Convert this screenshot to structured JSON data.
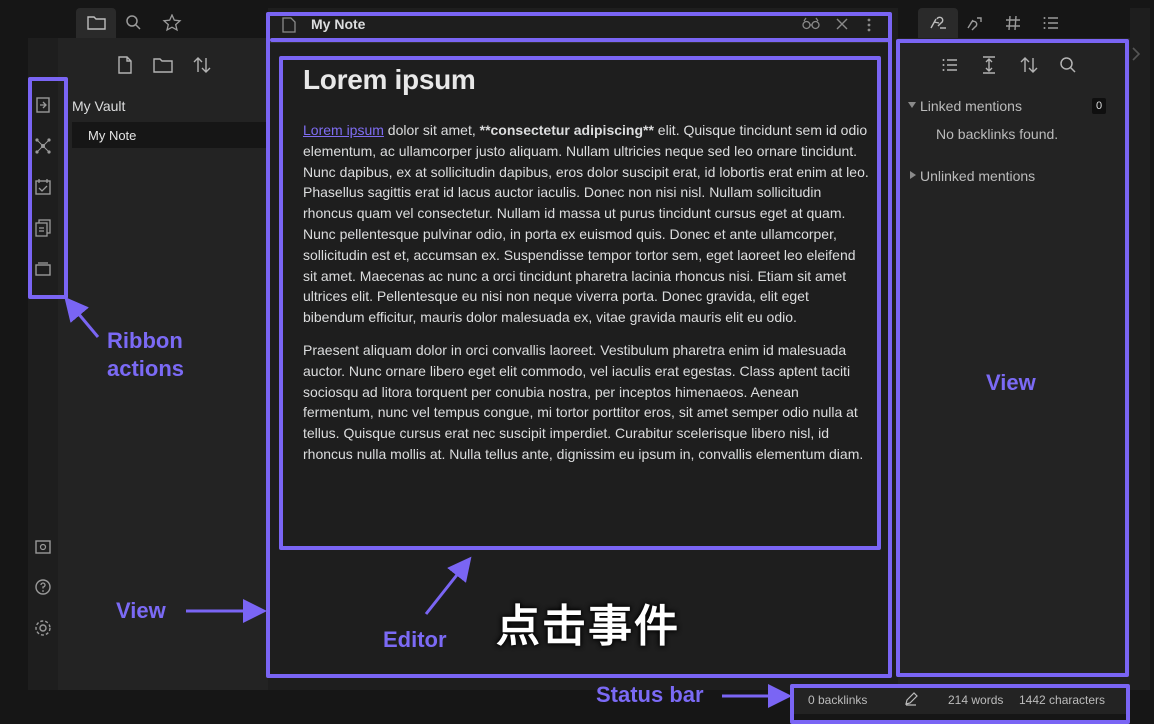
{
  "explorer": {
    "vault_name": "My Vault",
    "note_name": "My Note",
    "top_tabs": [
      "folder-icon",
      "search-icon",
      "star-icon"
    ],
    "actions": [
      "new-note-icon",
      "new-folder-icon",
      "sort-icon"
    ]
  },
  "ribbon": {
    "icons": [
      "open-switcher-icon",
      "graph-view-icon",
      "daily-note-icon",
      "templates-icon",
      "slides-icon",
      "vault-switch-icon",
      "help-icon",
      "settings-icon"
    ]
  },
  "editor": {
    "tab_title": "My Note",
    "heading": "Lorem ipsum",
    "p1_link": "Lorem ipsum",
    "p1_after_link": " dolor sit amet, ",
    "p1_bold": "**consectetur adipiscing**",
    "p1_rest": " elit. Quisque tincidunt sem id odio elementum, ac ullamcorper justo aliquam. Nullam ultricies neque sed leo ornare tincidunt. Nunc dapibus, ex at sollicitudin dapibus, eros dolor suscipit erat, id lobortis erat enim at leo. Phasellus sagittis erat id lacus auctor iaculis. Donec non nisi nisl. Nullam sollicitudin rhoncus quam vel consectetur. Nullam id massa ut purus tincidunt cursus eget at quam. Nunc pellentesque pulvinar odio, in porta ex euismod quis. Donec et ante ullamcorper, sollicitudin est et, accumsan ex. Suspendisse tempor tortor sem, eget laoreet leo eleifend sit amet. Maecenas ac nunc a orci tincidunt pharetra lacinia rhoncus nisi. Etiam sit amet ultrices elit. Pellentesque eu nisi non neque viverra porta. Donec gravida, elit eget bibendum efficitur, mauris dolor malesuada ex, vitae gravida mauris elit eu odio.",
    "p2": "Praesent aliquam dolor in orci convallis laoreet. Vestibulum pharetra enim id malesuada auctor. Nunc ornare libero eget elit commodo, vel iaculis erat egestas. Class aptent taciti sociosqu ad litora torquent per conubia nostra, per inceptos himenaeos. Aenean fermentum, nunc vel tempus congue, mi tortor porttitor eros, sit amet semper odio nulla at tellus. Quisque cursus erat nec suscipit imperdiet. Curabitur scelerisque libero nisl, id rhoncus nulla mollis at. Nulla tellus ante, dignissim eu ipsum in, convallis elementum diam."
  },
  "backlinks": {
    "linked_label": "Linked mentions",
    "linked_count": "0",
    "no_backlinks": "No backlinks found.",
    "unlinked_label": "Unlinked mentions"
  },
  "status": {
    "backlinks": "0 backlinks",
    "words": "214 words",
    "characters": "1442 characters"
  },
  "annotations": {
    "ribbon_line1": "Ribbon",
    "ribbon_line2": "actions",
    "view_left": "View",
    "editor": "Editor",
    "view_right": "View",
    "status_bar": "Status bar",
    "caption": "点击事件"
  },
  "colors": {
    "accent": "#7a65f4",
    "link": "#7f6df2",
    "background": "#1e1e1e"
  }
}
